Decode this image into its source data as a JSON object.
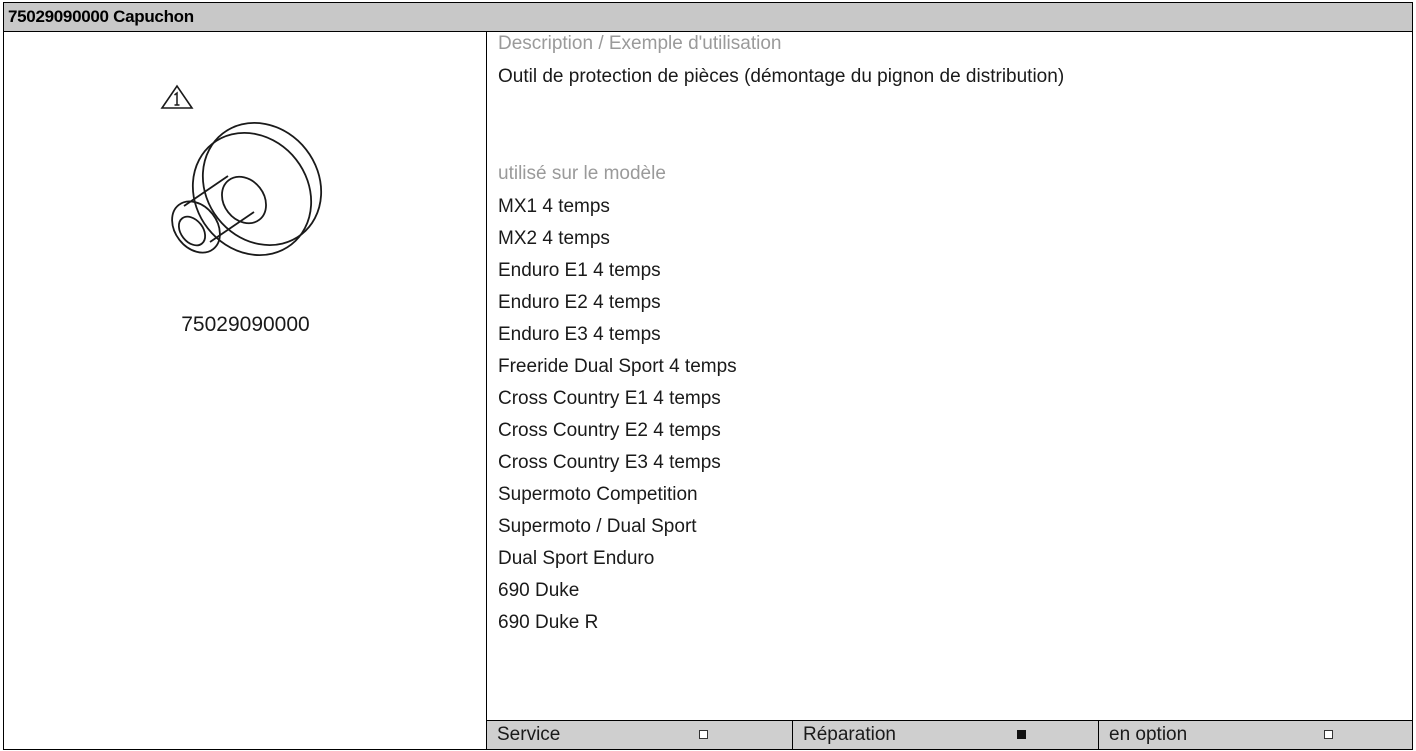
{
  "title": "75029090000 Capuchon",
  "figure": {
    "warning_icon": "warning-triangle-1-icon",
    "drawing": "cap-tool-drawing",
    "part_number": "75029090000"
  },
  "description": {
    "heading": "Description / Exemple d'utilisation",
    "text": "Outil de protection de pièces (démontage du pignon de distribution)"
  },
  "models": {
    "heading": "utilisé sur le modèle",
    "items": [
      "MX1 4 temps",
      "MX2 4 temps",
      "Enduro E1 4 temps",
      "Enduro E2 4 temps",
      "Enduro E3 4 temps",
      "Freeride Dual Sport 4 temps",
      "Cross Country E1 4 temps",
      "Cross Country E2 4 temps",
      "Cross Country E3 4 temps",
      "Supermoto Competition",
      "Supermoto / Dual Sport",
      "Dual Sport Enduro",
      "690 Duke",
      "690 Duke R"
    ]
  },
  "footer": {
    "service_label": "Service",
    "service_checked": false,
    "repair_label": "Réparation",
    "repair_checked": true,
    "option_label": "en option",
    "option_checked": false
  },
  "colors": {
    "header_bg": "#c8c8c8",
    "footer_bg": "#cfcfcf",
    "muted_text": "#9a9a9a"
  }
}
